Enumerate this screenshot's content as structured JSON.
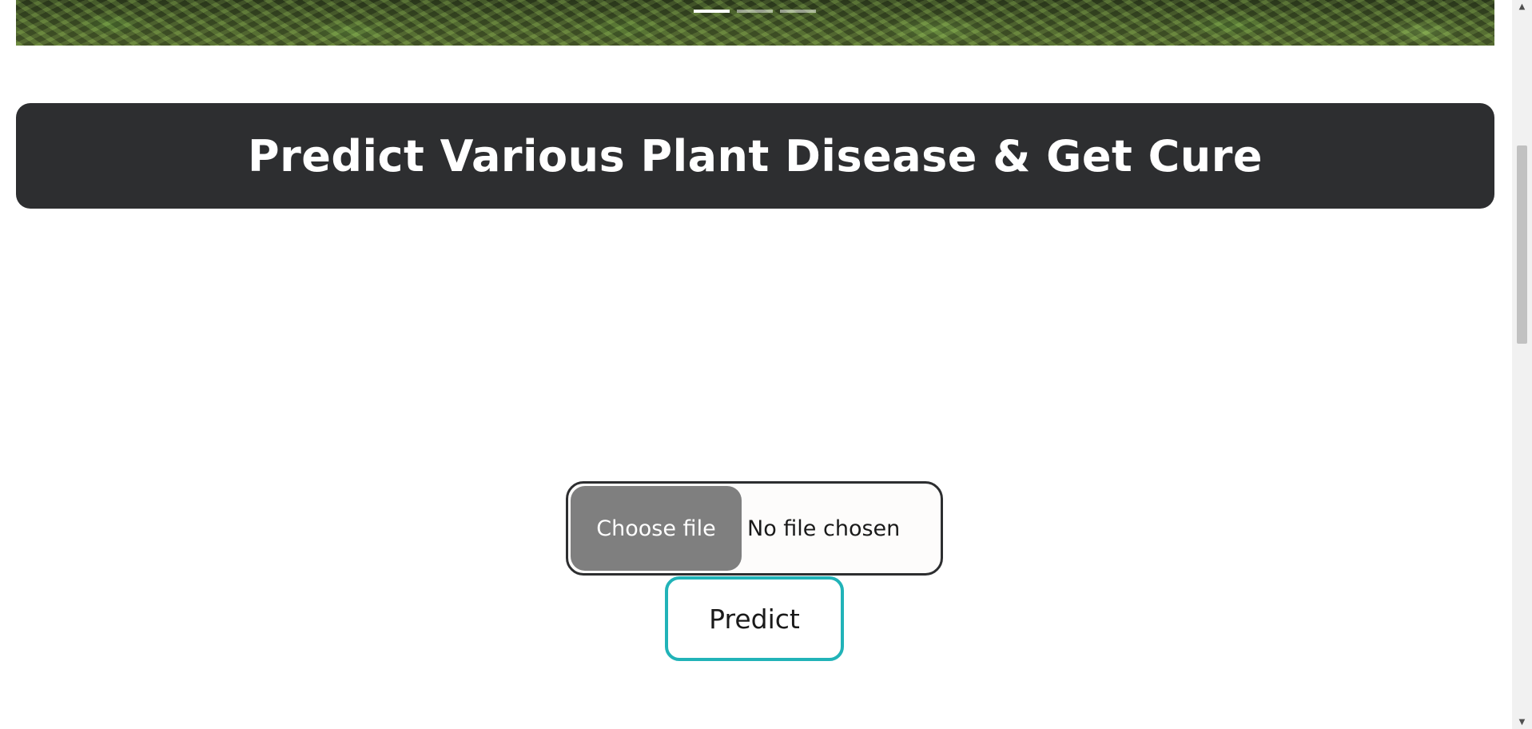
{
  "carousel": {
    "slides": [
      {
        "active": true
      },
      {
        "active": false
      },
      {
        "active": false
      }
    ]
  },
  "banner": {
    "title": "Predict Various Plant Disease & Get Cure"
  },
  "upload": {
    "choose_label": "Choose file",
    "status_text": "No file chosen"
  },
  "actions": {
    "predict_label": "Predict"
  },
  "colors": {
    "banner_bg": "#2d2e30",
    "predict_border": "#21b3b8",
    "choose_bg": "#7f7f7f"
  }
}
